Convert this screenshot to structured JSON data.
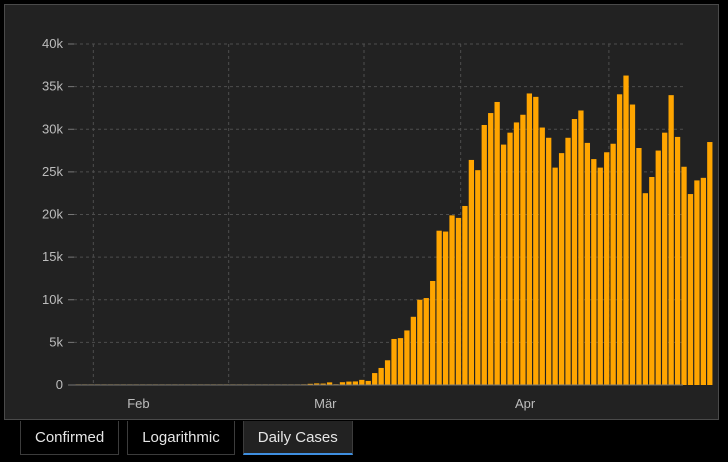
{
  "tabs": [
    {
      "label": "Confirmed",
      "active": false
    },
    {
      "label": "Logarithmic",
      "active": false
    },
    {
      "label": "Daily Cases",
      "active": true
    }
  ],
  "colors": {
    "bar": "#ffa500",
    "grid": "#4e4e4e",
    "axis": "#777777",
    "accent": "#3f8fe0"
  },
  "chart_data": {
    "type": "bar",
    "title": "",
    "xlabel": "",
    "ylabel": "",
    "grid": true,
    "ylim": [
      0,
      40000
    ],
    "y_ticks": [
      {
        "value": 0,
        "label": "0"
      },
      {
        "value": 5000,
        "label": "5k"
      },
      {
        "value": 10000,
        "label": "10k"
      },
      {
        "value": 15000,
        "label": "15k"
      },
      {
        "value": 20000,
        "label": "20k"
      },
      {
        "value": 25000,
        "label": "25k"
      },
      {
        "value": 30000,
        "label": "30k"
      },
      {
        "value": 35000,
        "label": "35k"
      },
      {
        "value": 40000,
        "label": "40k"
      }
    ],
    "x_ticks": [
      {
        "date": "2020-02-01",
        "label": "Feb"
      },
      {
        "date": "2020-03-01",
        "label": "Mär"
      },
      {
        "date": "2020-04-01",
        "label": "Apr"
      }
    ],
    "x_gridlines": [
      "2020-01-25",
      "2020-02-15",
      "2020-03-07",
      "2020-03-22",
      "2020-04-14"
    ],
    "dates": [
      "2020-01-22",
      "2020-01-23",
      "2020-01-24",
      "2020-01-25",
      "2020-01-26",
      "2020-01-27",
      "2020-01-28",
      "2020-01-29",
      "2020-01-30",
      "2020-01-31",
      "2020-02-01",
      "2020-02-02",
      "2020-02-03",
      "2020-02-04",
      "2020-02-05",
      "2020-02-06",
      "2020-02-07",
      "2020-02-08",
      "2020-02-09",
      "2020-02-10",
      "2020-02-11",
      "2020-02-12",
      "2020-02-13",
      "2020-02-14",
      "2020-02-15",
      "2020-02-16",
      "2020-02-17",
      "2020-02-18",
      "2020-02-19",
      "2020-02-20",
      "2020-02-21",
      "2020-02-22",
      "2020-02-23",
      "2020-02-24",
      "2020-02-25",
      "2020-02-26",
      "2020-02-27",
      "2020-02-28",
      "2020-02-29",
      "2020-03-01",
      "2020-03-02",
      "2020-03-03",
      "2020-03-04",
      "2020-03-05",
      "2020-03-06",
      "2020-03-07",
      "2020-03-08",
      "2020-03-09",
      "2020-03-10",
      "2020-03-11",
      "2020-03-12",
      "2020-03-13",
      "2020-03-14",
      "2020-03-15",
      "2020-03-16",
      "2020-03-17",
      "2020-03-18",
      "2020-03-19",
      "2020-03-20",
      "2020-03-21",
      "2020-03-22",
      "2020-03-23",
      "2020-03-24",
      "2020-03-25",
      "2020-03-26",
      "2020-03-27",
      "2020-03-28",
      "2020-03-29",
      "2020-03-30",
      "2020-03-31",
      "2020-04-01",
      "2020-04-02",
      "2020-04-03",
      "2020-04-04",
      "2020-04-05",
      "2020-04-06",
      "2020-04-07",
      "2020-04-08",
      "2020-04-09",
      "2020-04-10",
      "2020-04-11",
      "2020-04-12",
      "2020-04-13",
      "2020-04-14",
      "2020-04-15",
      "2020-04-16",
      "2020-04-17",
      "2020-04-18",
      "2020-04-19",
      "2020-04-20",
      "2020-04-21",
      "2020-04-22",
      "2020-04-23",
      "2020-04-24"
    ],
    "values": [
      0,
      1,
      1,
      1,
      2,
      2,
      2,
      3,
      3,
      1,
      0,
      2,
      3,
      1,
      1,
      0,
      1,
      1,
      0,
      1,
      1,
      1,
      0,
      1,
      1,
      0,
      0,
      0,
      1,
      1,
      1,
      1,
      10,
      20,
      60,
      80,
      140,
      190,
      170,
      310,
      90,
      330,
      400,
      420,
      600,
      480,
      1400,
      2000,
      2900,
      5400,
      5500,
      6400,
      8000,
      10000,
      10200,
      12200,
      18100,
      18000,
      19900,
      19600,
      21000,
      26400,
      25200,
      30500,
      31900,
      33200,
      28200,
      29600,
      30800,
      31700,
      34200,
      33800,
      30200,
      29000,
      25500,
      27200,
      29000,
      31200,
      32200,
      28400,
      26500,
      25500,
      27300,
      28300,
      34100,
      36300,
      32900,
      27800,
      22500,
      24400,
      27500,
      29600,
      34000,
      29100,
      25600,
      22400,
      24000,
      24300,
      28500
    ]
  }
}
